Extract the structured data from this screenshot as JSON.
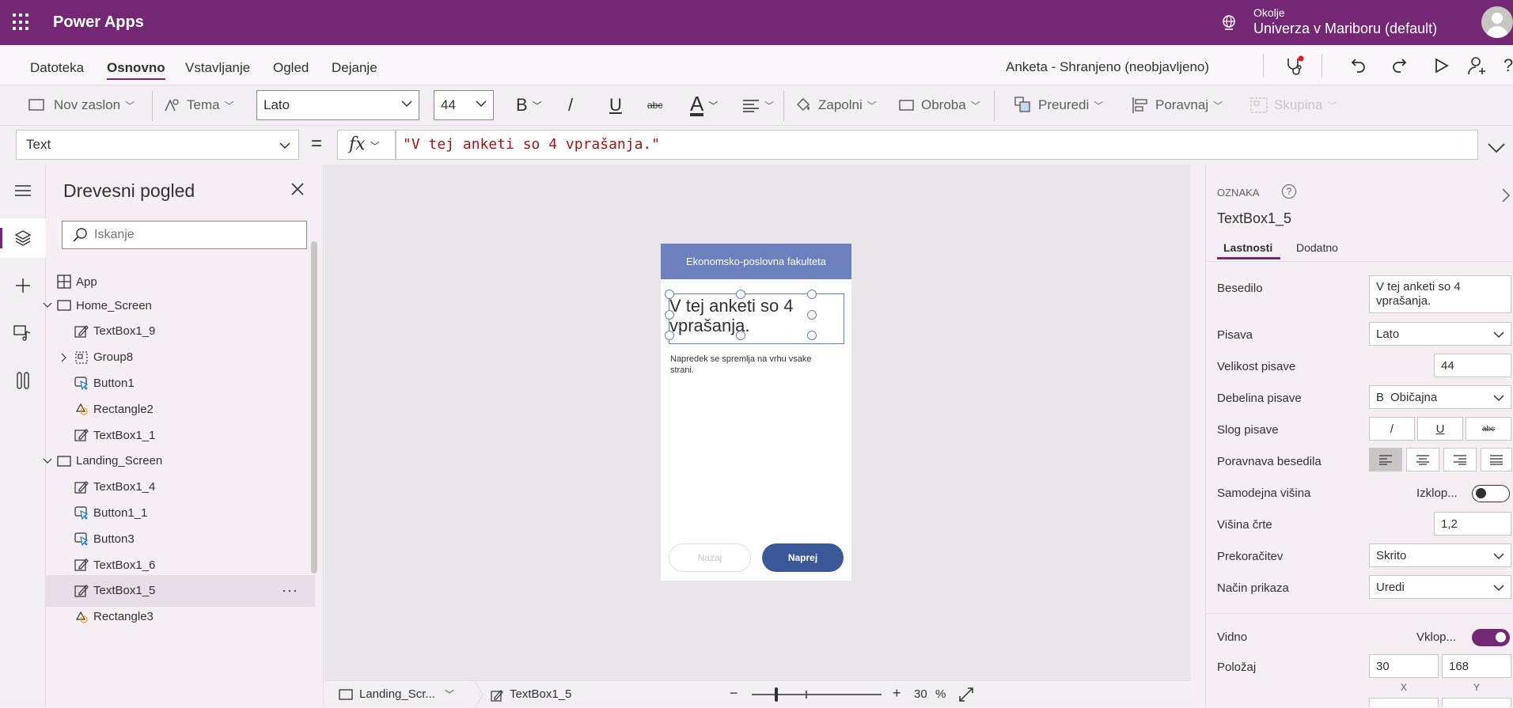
{
  "app": {
    "brand": "Power Apps",
    "environment_label": "Okolje",
    "environment_name": "Univerza v Mariboru (default)"
  },
  "menu": {
    "items": [
      "Datoteka",
      "Osnovno",
      "Vstavljanje",
      "Ogled",
      "Dejanje"
    ],
    "selected": "Osnovno",
    "doc_status": "Anketa - Shranjeno (neobjavljeno)"
  },
  "toolbar": {
    "new_screen": "Nov zaslon",
    "theme": "Tema",
    "font": "Lato",
    "font_size": "44",
    "bold": "B",
    "italic": "/",
    "underline": "U",
    "strike": "abc",
    "font_color": "A",
    "fill": "Zapolni",
    "border": "Obroba",
    "arrange": "Preuredi",
    "align": "Poravnaj",
    "group": "Skupina"
  },
  "formula": {
    "property": "Text",
    "equals": "=",
    "fx": "fx",
    "value": "\"V tej anketi so 4 vprašanja.\""
  },
  "tree": {
    "title": "Drevesni pogled",
    "search_placeholder": "Iskanje",
    "app_label": "App",
    "nodes": [
      {
        "label": "Home_Screen",
        "type": "screen"
      },
      {
        "label": "TextBox1_9",
        "type": "textbox"
      },
      {
        "label": "Group8",
        "type": "group"
      },
      {
        "label": "Button1",
        "type": "button"
      },
      {
        "label": "Rectangle2",
        "type": "shape"
      },
      {
        "label": "TextBox1_1",
        "type": "textbox"
      },
      {
        "label": "Landing_Screen",
        "type": "screen"
      },
      {
        "label": "TextBox1_4",
        "type": "textbox"
      },
      {
        "label": "Button1_1",
        "type": "button"
      },
      {
        "label": "Button3",
        "type": "button"
      },
      {
        "label": "TextBox1_6",
        "type": "textbox"
      },
      {
        "label": "TextBox1_5",
        "type": "textbox",
        "selected": true
      },
      {
        "label": "Rectangle3",
        "type": "shape"
      }
    ],
    "more": "···"
  },
  "phone": {
    "header": "Ekonomsko-poslovna fakulteta",
    "big_text": "V tej anketi so 4 vprašanja.",
    "small_text": "Napredek se spremlja na vrhu vsake strani.",
    "back_button": "Nazaj",
    "next_button": "Naprej"
  },
  "status": {
    "screen": "Landing_Scr...",
    "control": "TextBox1_5",
    "zoom_minus": "−",
    "zoom_plus": "+",
    "zoom_value": "30",
    "zoom_unit": "%",
    "zoom_level": 0.3
  },
  "properties": {
    "section": "OZNAKA",
    "control_name": "TextBox1_5",
    "tab_properties": "Lastnosti",
    "tab_advanced": "Dodatno",
    "text_label": "Besedilo",
    "text_value": "V tej anketi so 4 vprašanja.",
    "font_label": "Pisava",
    "font_value": "Lato",
    "size_label": "Velikost pisave",
    "size_value": "44",
    "weight_label": "Debelina pisave",
    "weight_prefix": "B",
    "weight_value": "Običajna",
    "style_label": "Slog pisave",
    "italic": "/",
    "underline": "U",
    "strike": "abc",
    "align_label": "Poravnava besedila",
    "autoheight_label": "Samodejna višina",
    "autoheight_value": "Izklop...",
    "lineheight_label": "Višina črte",
    "lineheight_value": "1,2",
    "overflow_label": "Prekoračitev",
    "overflow_value": "Skrito",
    "displaymode_label": "Način prikaza",
    "displaymode_value": "Uredi",
    "visible_label": "Vidno",
    "visible_value": "Vklop...",
    "position_label": "Položaj",
    "x_value": "30",
    "y_value": "168",
    "x_label": "X",
    "y_label": "Y"
  },
  "colors": {
    "brand": "#742774",
    "header": "#6b80bc",
    "primary_button": "#3b5999"
  }
}
